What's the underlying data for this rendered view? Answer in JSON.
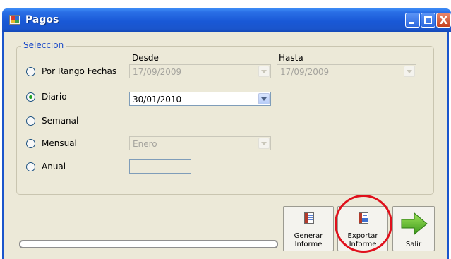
{
  "window": {
    "title": "Pagos",
    "buttons": {
      "minimize": "minimize",
      "maximize": "maximize",
      "close": "X"
    }
  },
  "seleccion": {
    "legend": "Seleccion",
    "desde_label": "Desde",
    "hasta_label": "Hasta",
    "options": {
      "rango": "Por Rango Fechas",
      "diario": "Diario",
      "semanal": "Semanal",
      "mensual": "Mensual",
      "anual": "Anual"
    },
    "selected": "diario",
    "desde_value": "17/09/2009",
    "hasta_value": "17/09/2009",
    "diario_value": "30/01/2010",
    "mensual_value": "Enero",
    "anual_value": ""
  },
  "actions": {
    "generar": [
      "Generar",
      "Informe"
    ],
    "exportar": [
      "Exportar",
      "Informe"
    ],
    "salir": "Salir"
  },
  "progress": {
    "value": 0
  },
  "colors": {
    "accent": "#1a55cc",
    "highlight_circle": "#e0101c"
  },
  "icons": {
    "generar": "report-icon",
    "exportar": "export-report-icon",
    "salir": "green-arrow-right-icon"
  }
}
